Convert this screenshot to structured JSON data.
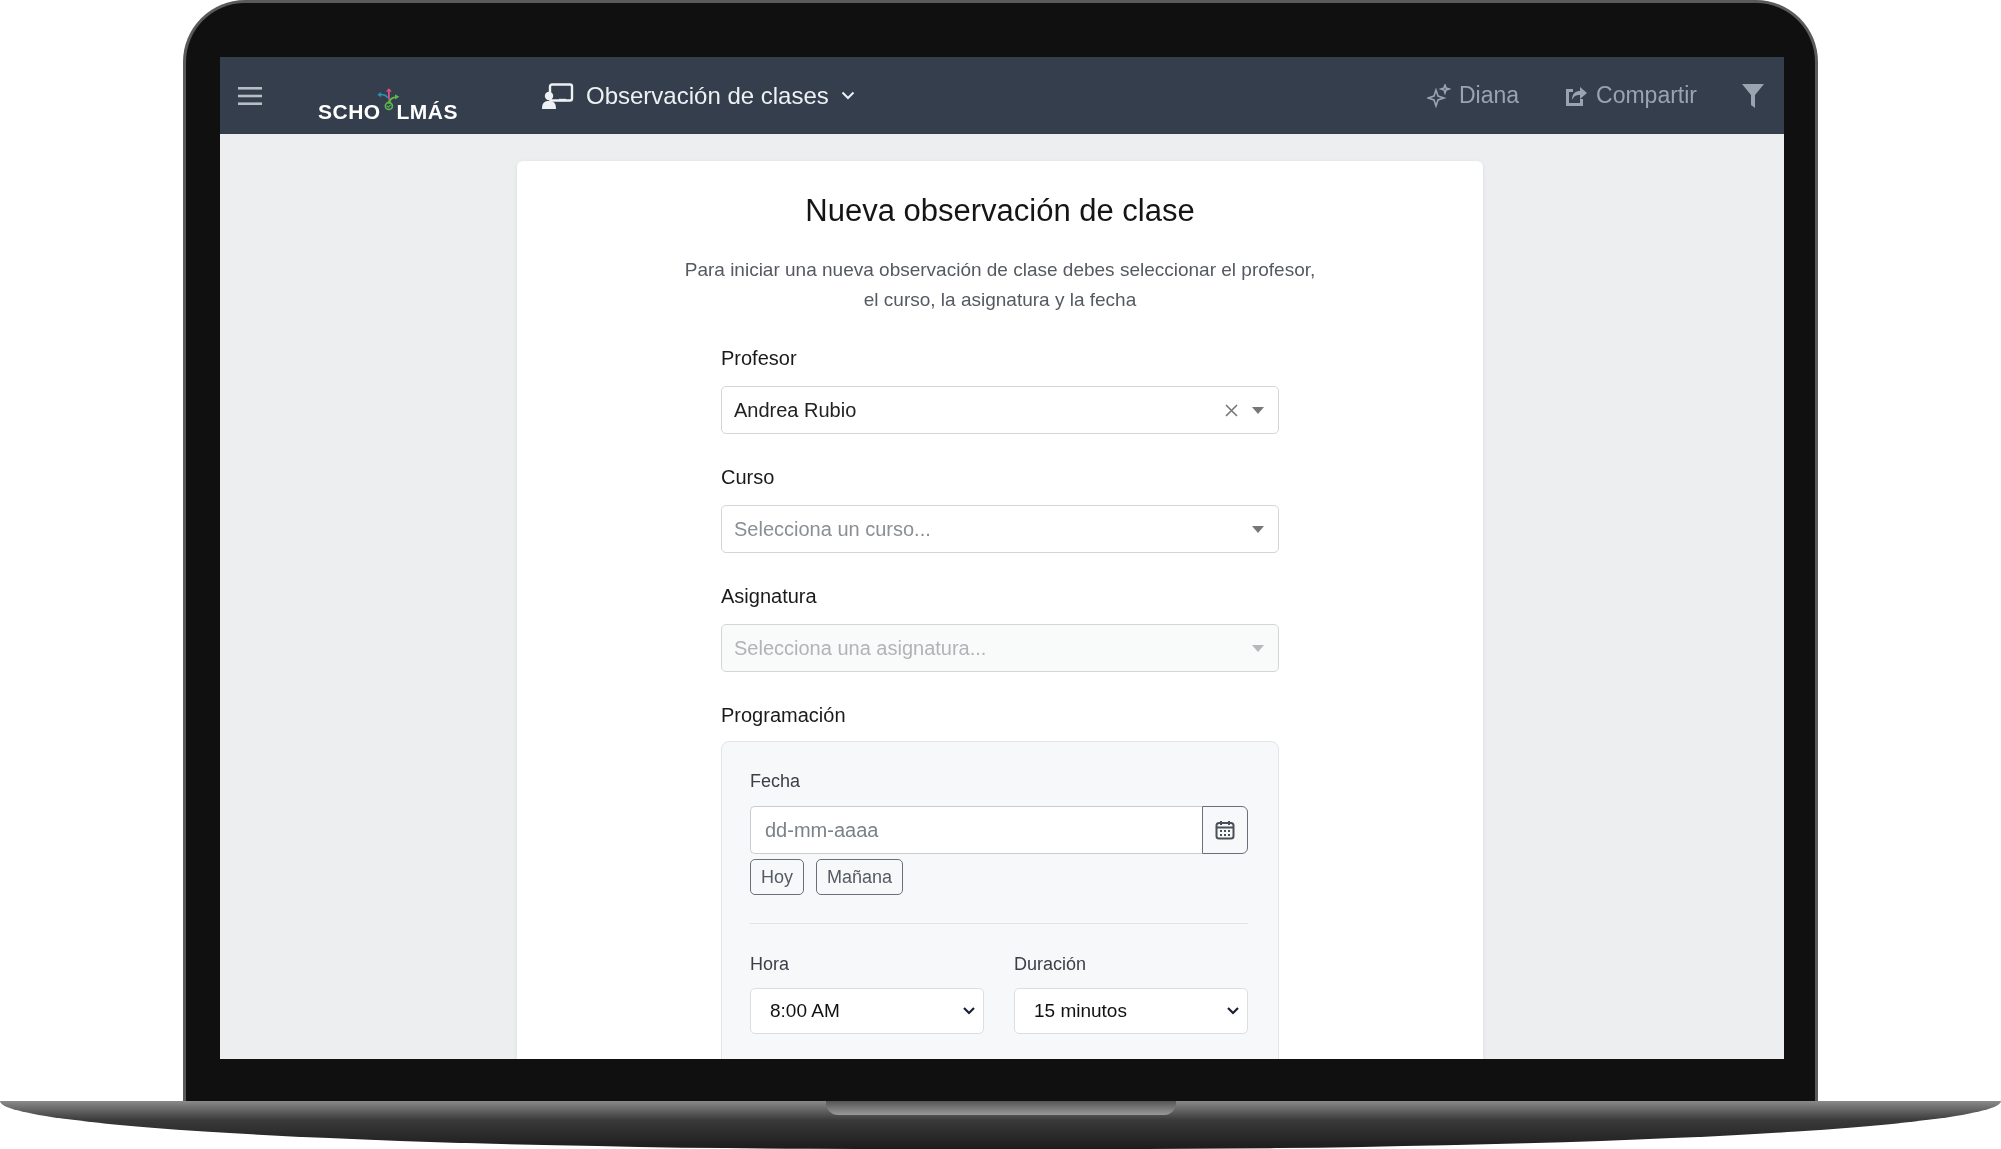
{
  "header": {
    "logo": {
      "text_left": "SCHO",
      "text_right": "LMÁS"
    },
    "module": {
      "title": "Observación de clases"
    },
    "actions": [
      {
        "kind": "assistant",
        "label": "Diana"
      },
      {
        "kind": "share",
        "label": "Compartir"
      },
      {
        "kind": "filter"
      }
    ]
  },
  "form": {
    "title": "Nueva observación de clase",
    "description_lines": [
      "Para iniciar una nueva observación de clase debes seleccionar el profesor,",
      "el curso, la asignatura y la fecha"
    ],
    "fields": [
      {
        "label": "Profesor",
        "value": "Andrea Rubio",
        "clearable": true,
        "disabled": false
      },
      {
        "label": "Curso",
        "placeholder": "Selecciona un curso...",
        "clearable": false,
        "disabled": false
      },
      {
        "label": "Asignatura",
        "placeholder": "Selecciona una asignatura...",
        "clearable": false,
        "disabled": true
      }
    ],
    "scheduling": {
      "title": "Programación",
      "date": {
        "label": "Fecha",
        "placeholder": "dd-mm-aaaa"
      },
      "quick_dates": [
        "Hoy",
        "Mañana"
      ],
      "time": {
        "label": "Hora",
        "value": "8:00 AM"
      },
      "duration": {
        "label": "Duración",
        "value": "15 minutos"
      }
    }
  }
}
